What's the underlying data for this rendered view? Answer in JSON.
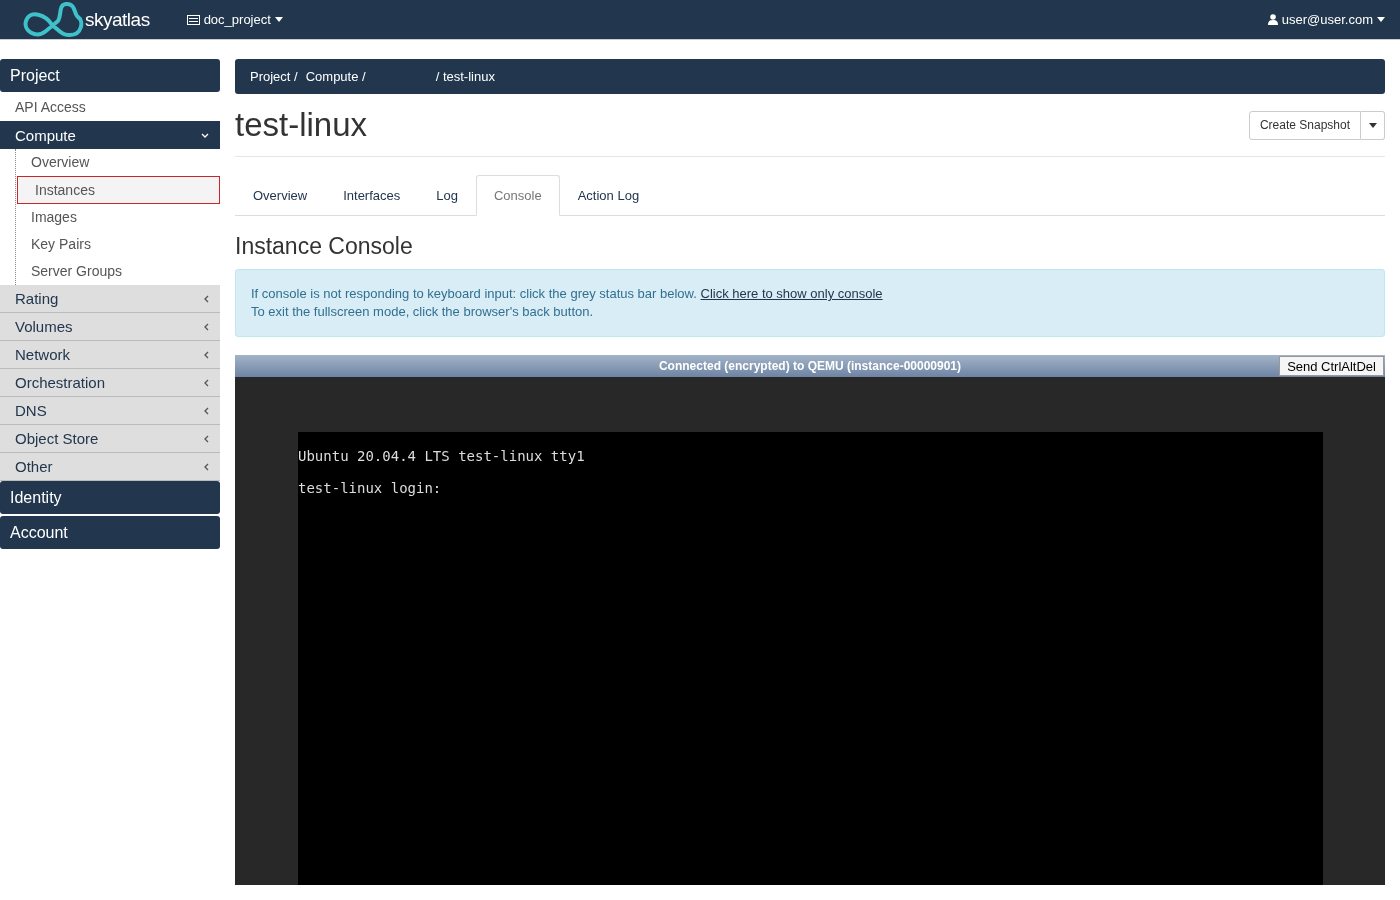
{
  "topbar": {
    "brand": "skyatlas",
    "project": "doc_project",
    "user": "user@user.com"
  },
  "sidebar": {
    "panels": [
      {
        "label": "Project",
        "groups": [
          {
            "label": "API Access",
            "kind": "link"
          },
          {
            "label": "Compute",
            "kind": "group",
            "expanded": true,
            "children": [
              {
                "label": "Overview",
                "selected": false
              },
              {
                "label": "Instances",
                "selected": true
              },
              {
                "label": "Images",
                "selected": false
              },
              {
                "label": "Key Pairs",
                "selected": false
              },
              {
                "label": "Server Groups",
                "selected": false
              }
            ]
          },
          {
            "label": "Rating",
            "kind": "group",
            "expanded": false
          },
          {
            "label": "Volumes",
            "kind": "group",
            "expanded": false
          },
          {
            "label": "Network",
            "kind": "group",
            "expanded": false
          },
          {
            "label": "Orchestration",
            "kind": "group",
            "expanded": false
          },
          {
            "label": "DNS",
            "kind": "group",
            "expanded": false
          },
          {
            "label": "Object Store",
            "kind": "group",
            "expanded": false
          },
          {
            "label": "Other",
            "kind": "group",
            "expanded": false
          }
        ]
      },
      {
        "label": "Identity"
      },
      {
        "label": "Account"
      }
    ]
  },
  "breadcrumb": [
    {
      "label": "Project /",
      "kind": "item"
    },
    {
      "label": "Compute /",
      "kind": "item"
    },
    {
      "label": "/ test-linux",
      "kind": "current"
    }
  ],
  "page_title": "test-linux",
  "actions": {
    "primary": "Create Snapshot"
  },
  "tabs": [
    {
      "label": "Overview",
      "selected": false
    },
    {
      "label": "Interfaces",
      "selected": false
    },
    {
      "label": "Log",
      "selected": false
    },
    {
      "label": "Console",
      "selected": true
    },
    {
      "label": "Action Log",
      "selected": false
    }
  ],
  "section_title": "Instance Console",
  "info": {
    "line1": "If console is not responding to keyboard input: click the grey status bar below.",
    "link": "Click here to show only console",
    "line2": "To exit the fullscreen mode, click the browser's back button."
  },
  "console": {
    "status": "Connected (encrypted) to QEMU (instance-00000901)",
    "button": "Send CtrlAltDel",
    "lines": [
      "Ubuntu 20.04.4 LTS test-linux tty1",
      "test-linux login:"
    ]
  }
}
